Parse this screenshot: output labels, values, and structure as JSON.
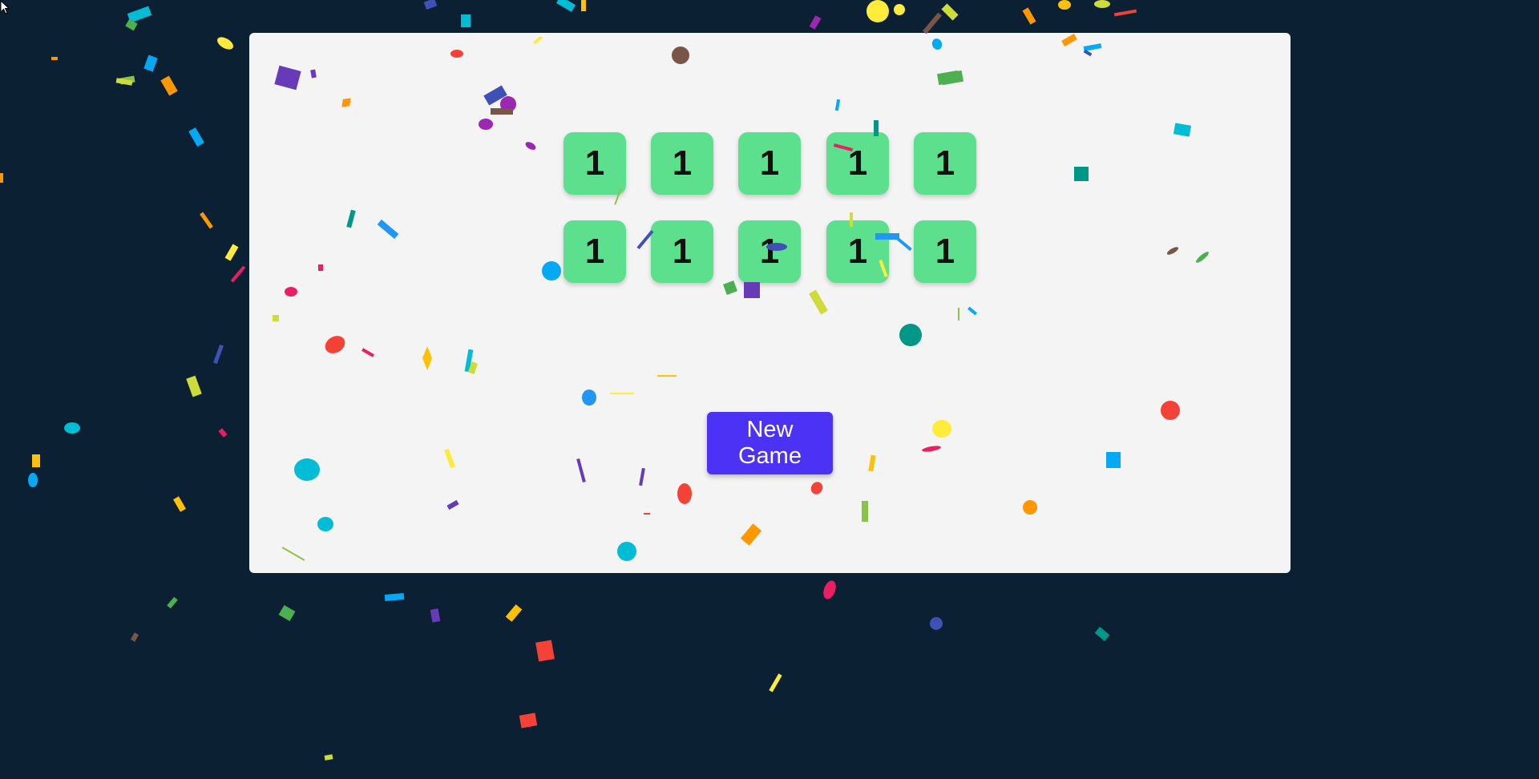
{
  "game": {
    "dice": [
      "1",
      "1",
      "1",
      "1",
      "1",
      "1",
      "1",
      "1",
      "1",
      "1"
    ],
    "new_game_label": "New Game"
  },
  "colors": {
    "page_background": "#0b2133",
    "board_background": "#f4f4f4",
    "die_color": "#5ce08e",
    "button_color": "#4b32f5",
    "confetti_palette": [
      "#f44336",
      "#e91e63",
      "#9c27b0",
      "#673ab7",
      "#3f51b5",
      "#2196f3",
      "#03a9f4",
      "#00bcd4",
      "#009688",
      "#4caf50",
      "#8bc34a",
      "#cddc39",
      "#ffeb3b",
      "#ffc107",
      "#ff9800",
      "#795548"
    ]
  }
}
